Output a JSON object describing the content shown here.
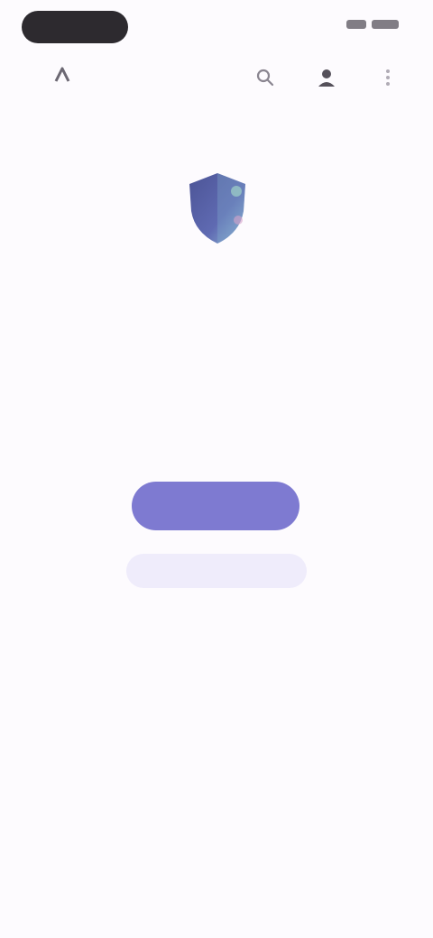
{
  "status_bar": {
    "pill_label": ""
  },
  "app_bar": {
    "logo_text": "",
    "icons": [
      "search-icon",
      "account-icon",
      "more-icon"
    ]
  },
  "hero": {
    "icon": "shield-icon",
    "title": "",
    "subtitle": "",
    "note": ""
  },
  "actions": {
    "primary_label": "",
    "secondary_label": "",
    "link_label": ""
  },
  "colors": {
    "background": "#fdfbfe",
    "accent": "#7e7ad1",
    "accent_soft": "#efecfb",
    "shield_blue": "#5b63a8",
    "text_primary": "#2b2730",
    "text_secondary": "#7a7580"
  }
}
